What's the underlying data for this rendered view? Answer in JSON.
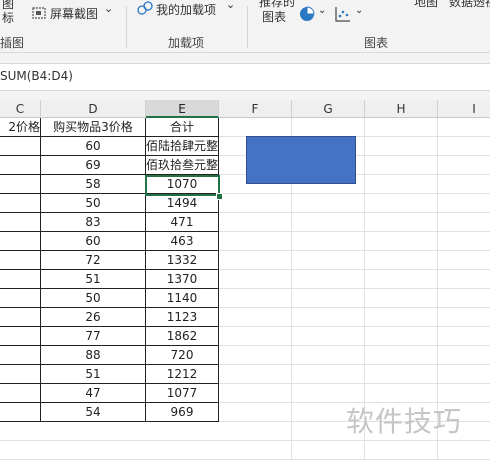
{
  "ribbon": {
    "insert_illustration": {
      "line1": "图",
      "line2": "标"
    },
    "screenshot_label": "屏幕截图",
    "screenshot_dropdown": "⌄",
    "addins_label": "我的加载项",
    "addins_dropdown": "⌄",
    "recommended_charts": {
      "line1": "推荐的",
      "line2": "图表"
    },
    "maps_label": "地图",
    "pivot_chart_label": "数据透视",
    "groups": {
      "illustrations": "插图",
      "addins": "加载项",
      "charts": "图表"
    }
  },
  "formula_bar": {
    "text": "SUM(B4:D4)"
  },
  "columns": [
    {
      "label": "C"
    },
    {
      "label": "D"
    },
    {
      "label": "E"
    },
    {
      "label": "F"
    },
    {
      "label": "G"
    },
    {
      "label": "H"
    },
    {
      "label": "I"
    }
  ],
  "table": {
    "header_c": "2价格",
    "header_d": "购买物品3价格",
    "header_e": "合计",
    "rows": [
      {
        "d": "60",
        "e": "佰陆拾肆元整"
      },
      {
        "d": "69",
        "e": "佰玖拾叁元整"
      },
      {
        "d": "58",
        "e": "1070"
      },
      {
        "d": "50",
        "e": "1494"
      },
      {
        "d": "83",
        "e": "471"
      },
      {
        "d": "60",
        "e": "463"
      },
      {
        "d": "72",
        "e": "1332"
      },
      {
        "d": "51",
        "e": "1370"
      },
      {
        "d": "50",
        "e": "1140"
      },
      {
        "d": "26",
        "e": "1123"
      },
      {
        "d": "77",
        "e": "1862"
      },
      {
        "d": "88",
        "e": "720"
      },
      {
        "d": "51",
        "e": "1212"
      },
      {
        "d": "47",
        "e": "1077"
      },
      {
        "d": "54",
        "e": "969"
      }
    ]
  },
  "watermark": "软件技巧",
  "colors": {
    "accent": "#217346",
    "shape_fill": "#4472c4"
  }
}
